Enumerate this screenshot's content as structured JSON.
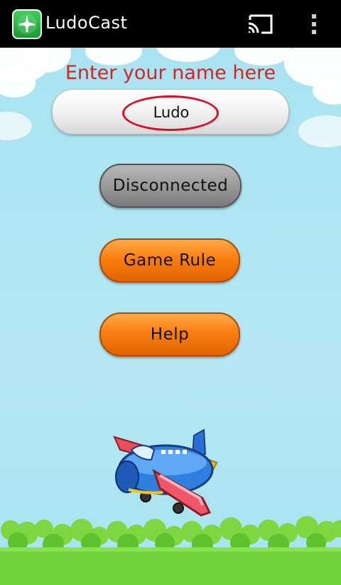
{
  "app": {
    "title": "LudoCast",
    "icon": "airplane-app-icon"
  },
  "toolbar": {
    "cast_icon": "cast-icon",
    "overflow_icon": "overflow-menu-icon"
  },
  "main": {
    "prompt": "Enter your name here",
    "name_value": "Ludo",
    "buttons": {
      "connection": "Disconnected",
      "game_rule": "Game  Rule",
      "help": "Help"
    }
  },
  "colors": {
    "prompt_text": "#d92323",
    "highlight_ring": "#d7102a",
    "button_orange": "#fb7e10",
    "button_gray": "#9b9b9b",
    "sky": "#b6e8f4",
    "grass": "#6fd23a"
  }
}
